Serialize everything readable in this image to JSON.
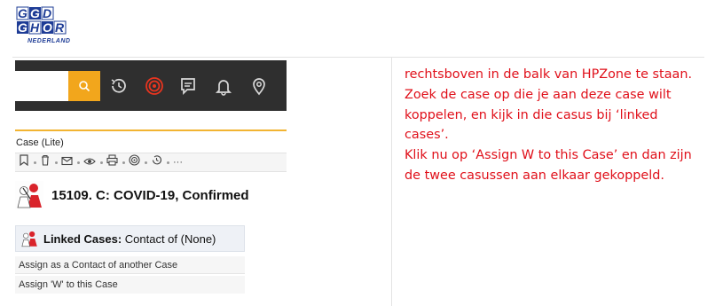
{
  "logo": {
    "line1": "GGD",
    "line2": "GHOR",
    "line3": "NEDERLAND"
  },
  "toolbar": {
    "icons": [
      "search-icon",
      "history-icon",
      "target-icon",
      "message-icon",
      "bell-icon",
      "location-pin-icon"
    ],
    "colors": {
      "bar": "#2f2f2f",
      "search_button": "#f2a61c",
      "target": "#e8341f",
      "icon": "#d9d9d9"
    }
  },
  "case": {
    "title": "Case (Lite)",
    "actions": [
      "bookmark-icon",
      "trash-icon",
      "mail-icon",
      "eye-icon",
      "print-icon",
      "target-icon",
      "history-icon",
      "more-icon"
    ],
    "more_label": "···",
    "heading": "15109. C: COVID-19, Confirmed"
  },
  "linked": {
    "title_bold": "Linked Cases:",
    "title_rest": " Contact of (None)",
    "items": [
      "Assign as a Contact of another Case",
      "Assign 'W' to this Case"
    ]
  },
  "instructions": {
    "color": "#e0101a",
    "text": "rechtsboven in de balk van HPZone te staan.\nZoek de case op die je aan deze case wilt koppelen, en kijk in die casus bij ‘linked cases’.\nKlik nu op ‘Assign W to this Case’ en dan zijn de twee casussen aan elkaar gekoppeld."
  }
}
